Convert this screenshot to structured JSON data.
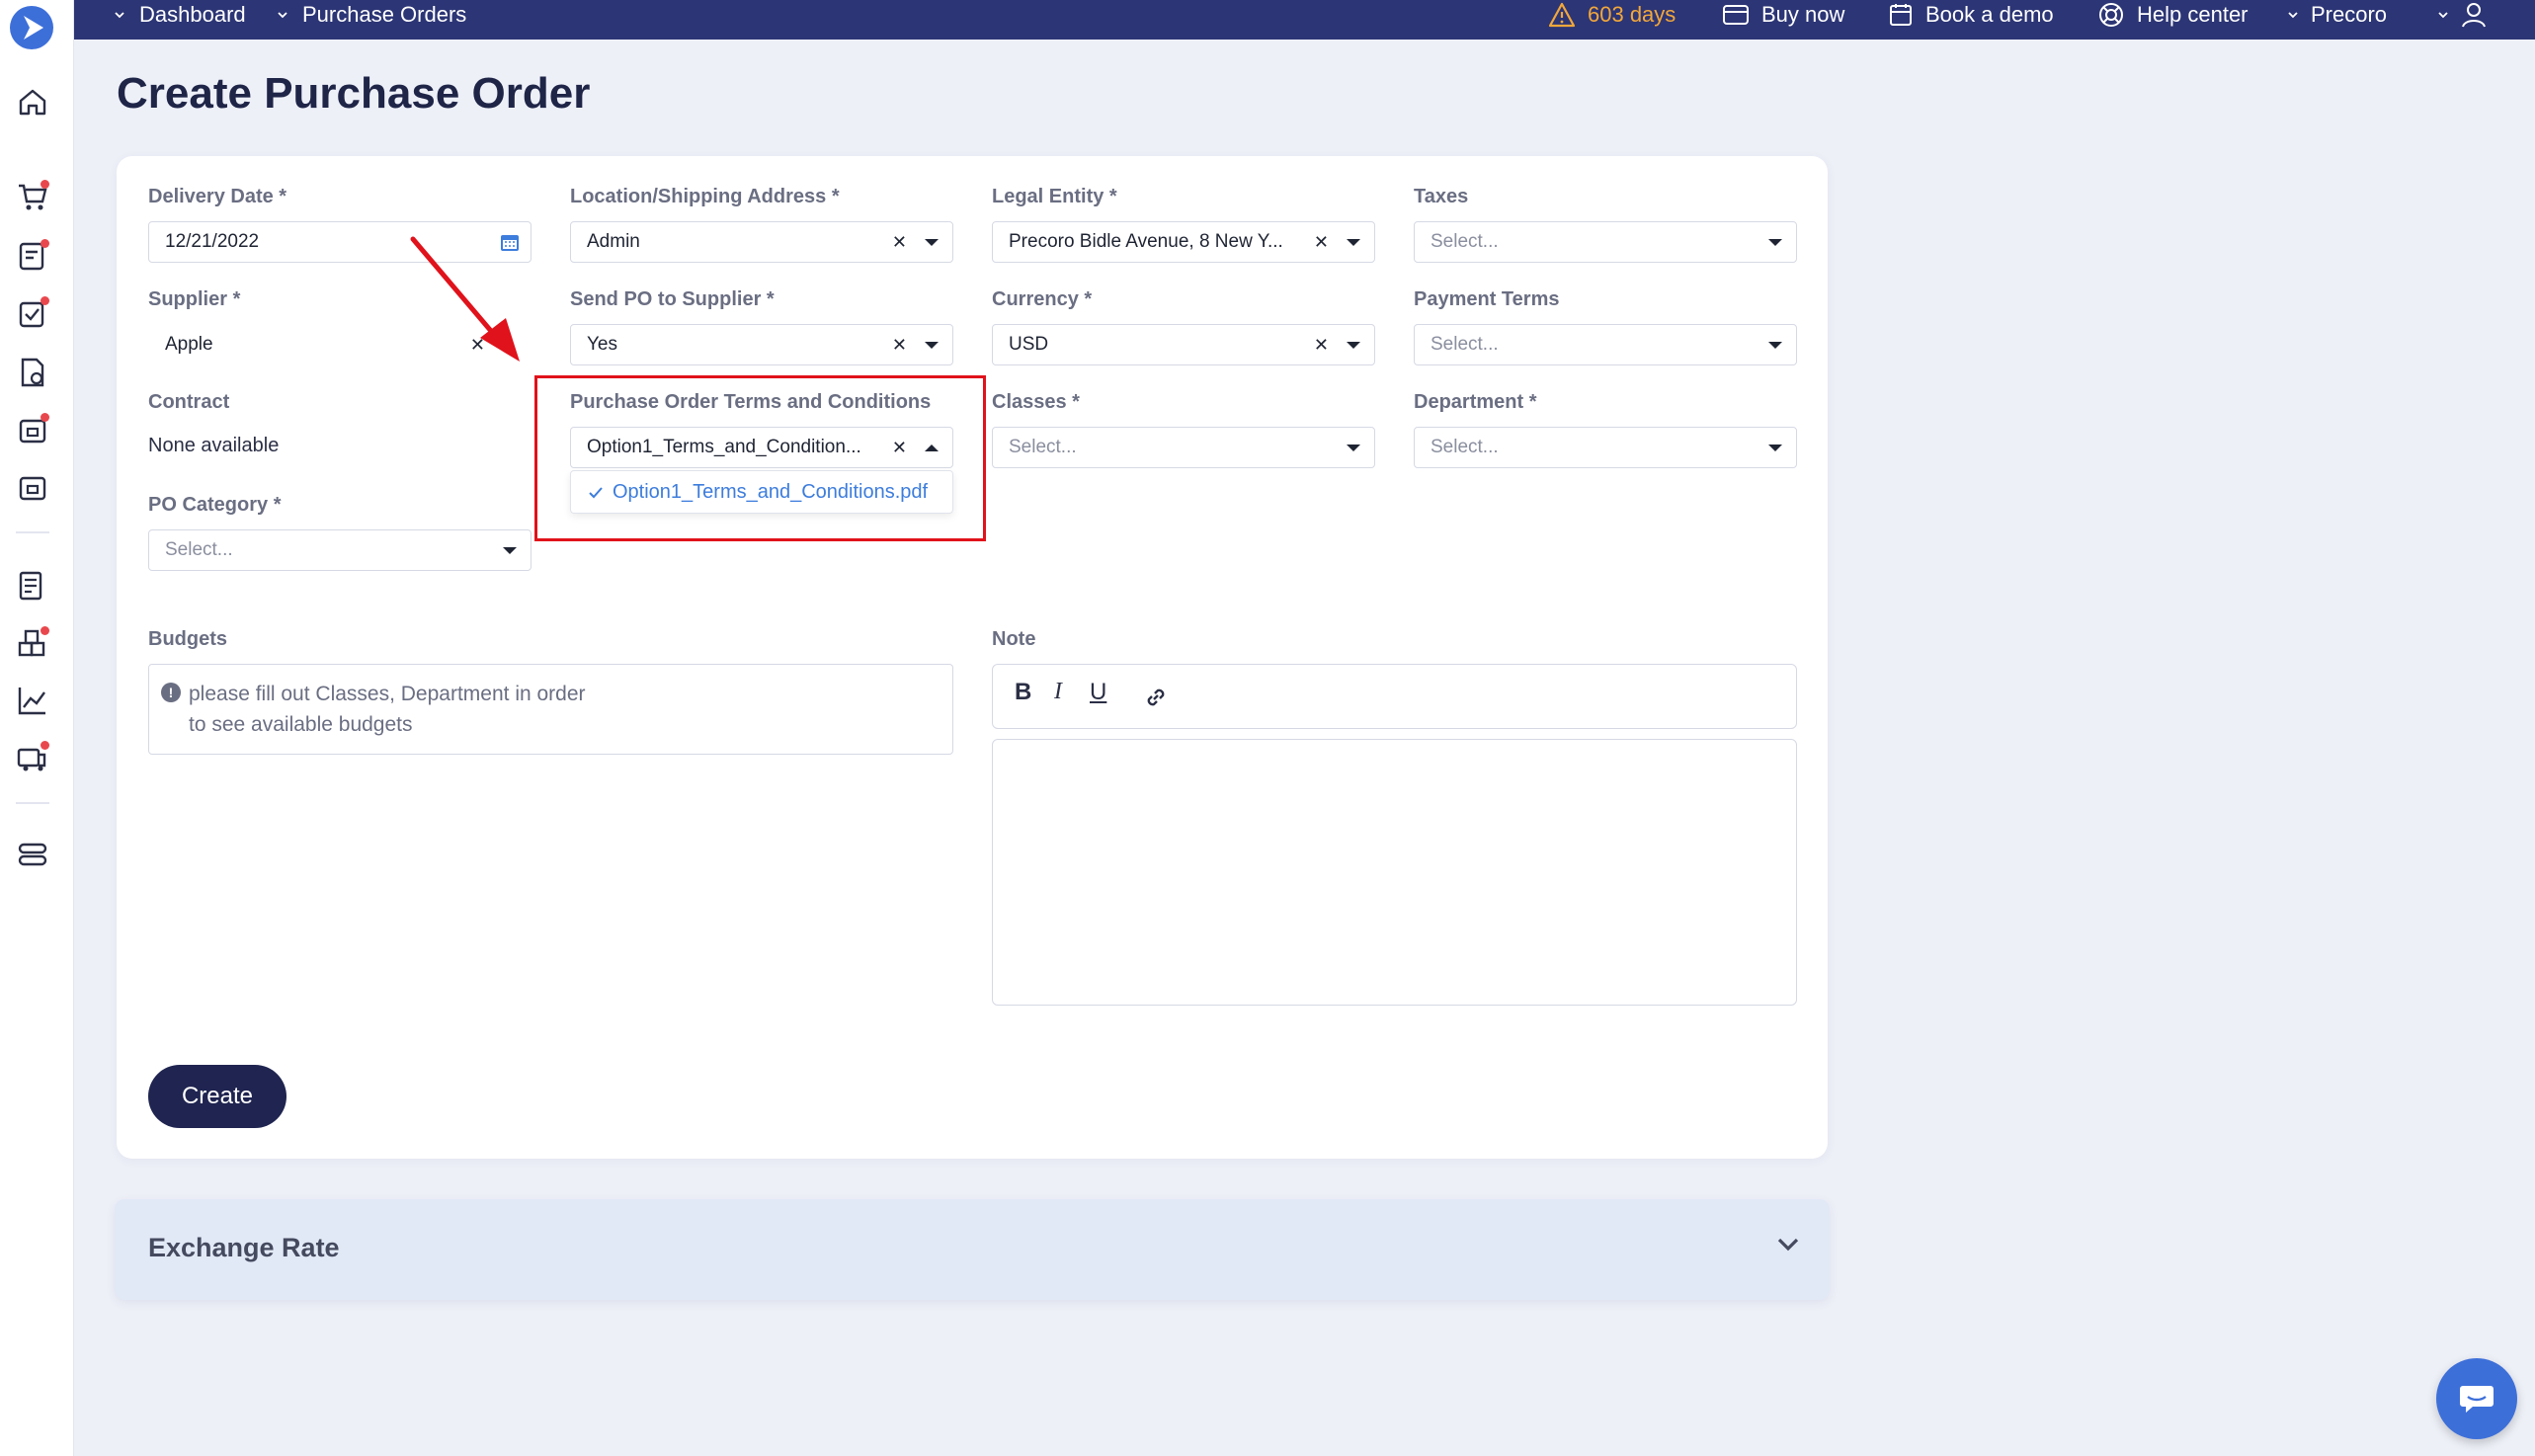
{
  "topbar": {
    "breadcrumbs": [
      "Dashboard",
      "Purchase Orders"
    ],
    "warning": "603 days",
    "buy_now": "Buy now",
    "book_demo": "Book a demo",
    "help_center": "Help center",
    "company": "Precoro"
  },
  "page": {
    "title": "Create Purchase Order"
  },
  "form": {
    "delivery_date": {
      "label": "Delivery Date *",
      "value": "12/21/2022"
    },
    "location": {
      "label": "Location/Shipping Address *",
      "value": "Admin"
    },
    "legal_entity": {
      "label": "Legal Entity *",
      "value": "Precoro Bidle Avenue, 8 New Y..."
    },
    "taxes": {
      "label": "Taxes",
      "placeholder": "Select..."
    },
    "supplier": {
      "label": "Supplier *",
      "value": "Apple"
    },
    "send_po": {
      "label": "Send PO to Supplier *",
      "value": "Yes"
    },
    "currency": {
      "label": "Currency *",
      "value": "USD"
    },
    "payment_terms": {
      "label": "Payment Terms",
      "placeholder": "Select..."
    },
    "contract": {
      "label": "Contract",
      "value": "None available"
    },
    "terms": {
      "label": "Purchase Order Terms and Conditions",
      "value": "Option1_Terms_and_Condition...",
      "options": [
        "Option1_Terms_and_Conditions.pdf"
      ]
    },
    "classes": {
      "label": "Classes *",
      "placeholder": "Select..."
    },
    "department": {
      "label": "Department *",
      "placeholder": "Select..."
    },
    "po_category": {
      "label": "PO Category *",
      "placeholder": "Select..."
    },
    "budgets": {
      "label": "Budgets",
      "message": "please fill out Classes, Department in order to see available budgets"
    },
    "note": {
      "label": "Note",
      "toolbar": {
        "bold": "B",
        "italic": "I",
        "underline": "U"
      }
    },
    "create_label": "Create"
  },
  "exchange_rate": {
    "label": "Exchange Rate"
  },
  "colors": {
    "topbar": "#2c3575",
    "accent": "#3d6fd9",
    "primary_button": "#1f2450",
    "highlight": "#e0121b",
    "warning": "#f2a73b"
  },
  "icons": [
    "logo-icon",
    "home-icon",
    "cart-icon",
    "request-icon",
    "approval-icon",
    "invoice-icon",
    "receipt-icon",
    "wallet-icon",
    "catalog-icon",
    "warehouse-icon",
    "analytics-icon",
    "delivery-icon",
    "settings-icon",
    "calendar-icon",
    "link-icon",
    "chat-icon"
  ]
}
